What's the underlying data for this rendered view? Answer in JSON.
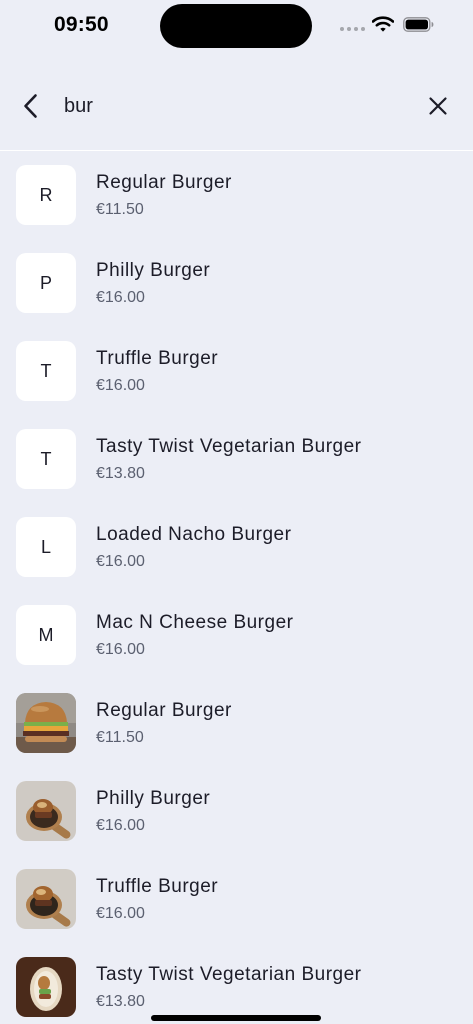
{
  "status_bar": {
    "time": "09:50"
  },
  "search": {
    "query": "bur"
  },
  "icons": {
    "back": "chevron-left-icon",
    "clear": "close-icon",
    "wifi": "wifi-icon",
    "battery": "battery-icon"
  },
  "colors": {
    "background": "#eceef6",
    "card": "#ffffff",
    "text": "#1c1c28",
    "price": "#5b6070"
  },
  "results": [
    {
      "initial": "R",
      "name": "Regular Burger",
      "price": "€11.50"
    },
    {
      "initial": "P",
      "name": "Philly Burger",
      "price": "€16.00"
    },
    {
      "initial": "T",
      "name": "Truffle Burger",
      "price": "€16.00"
    },
    {
      "initial": "T",
      "name": "Tasty Twist Vegetarian Burger",
      "price": "€13.80"
    },
    {
      "initial": "L",
      "name": "Loaded Nacho Burger",
      "price": "€16.00"
    },
    {
      "initial": "M",
      "name": "Mac N Cheese Burger",
      "price": "€16.00"
    },
    {
      "photo": "burger-photo",
      "name": "Regular Burger",
      "price": "€11.50"
    },
    {
      "photo": "burger-board-photo",
      "name": "Philly Burger",
      "price": "€16.00"
    },
    {
      "photo": "burger-board-photo",
      "name": "Truffle Burger",
      "price": "€16.00"
    },
    {
      "photo": "veg-burger-photo",
      "name": "Tasty Twist Vegetarian Burger",
      "price": "€13.80"
    }
  ]
}
